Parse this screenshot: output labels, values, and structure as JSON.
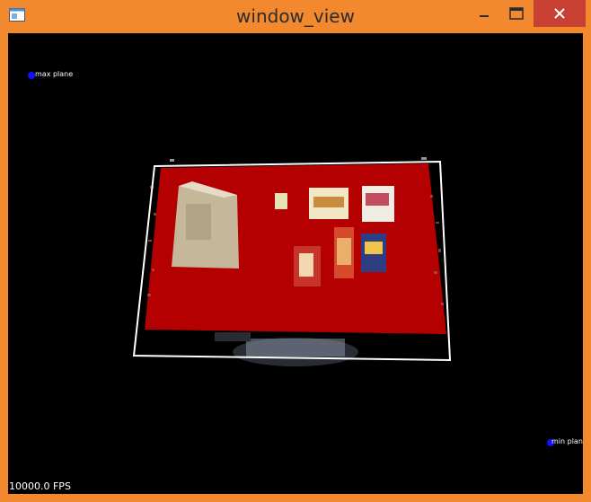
{
  "window": {
    "title": "window_view",
    "frame_color": "#f3892f",
    "close_color": "#c84031"
  },
  "icons": {
    "app": "window-app-icon",
    "minimize": "minimize-icon",
    "maximize": "maximize-icon",
    "close": "close-icon"
  },
  "viewport": {
    "background": "#000000",
    "max_plane_label": "max plane",
    "min_plane_label": "min plane",
    "fps_text": "10000.0 FPS",
    "plane_color": "#b40000",
    "marker_color": "#1010ff"
  }
}
